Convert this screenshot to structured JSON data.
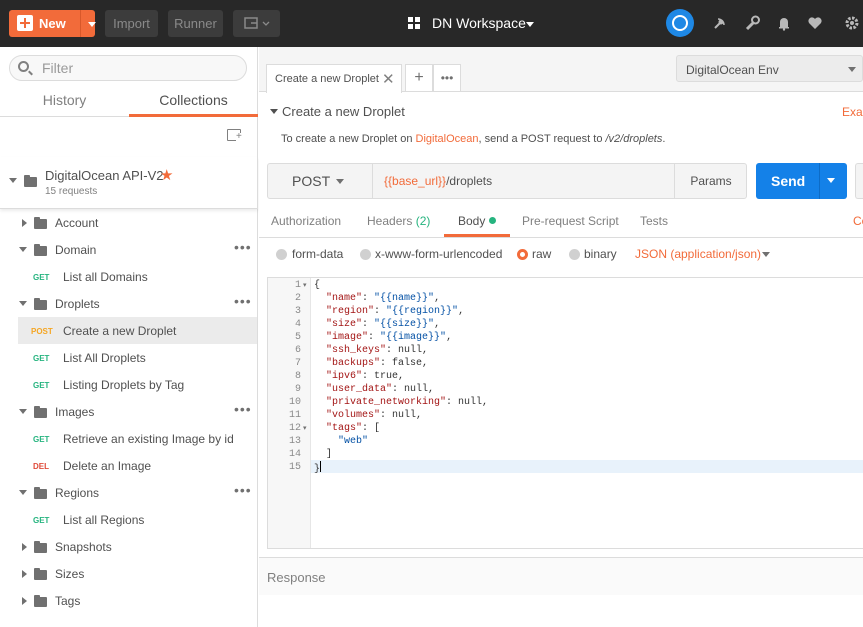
{
  "topbar": {
    "new_label": "New",
    "import_label": "Import",
    "runner_label": "Runner",
    "workspace_name": "DN Workspace",
    "icons": [
      "sync-icon",
      "satellite-icon",
      "wrench-icon",
      "bell-icon",
      "heart-icon",
      "settings-icon"
    ]
  },
  "sidebar": {
    "filter_placeholder": "Filter",
    "tabs": [
      {
        "label": "History"
      },
      {
        "label": "Collections",
        "active": true
      }
    ],
    "collection": {
      "name": "DigitalOcean API-V2",
      "count": "15 requests",
      "starred": true
    },
    "items": [
      {
        "type": "folder",
        "label": "Account",
        "expanded": false
      },
      {
        "type": "folder",
        "label": "Domain",
        "expanded": true
      },
      {
        "type": "request",
        "method": "GET",
        "label": "List all Domains"
      },
      {
        "type": "folder",
        "label": "Droplets",
        "expanded": true
      },
      {
        "type": "request",
        "method": "POST",
        "label": "Create a new Droplet",
        "selected": true
      },
      {
        "type": "request",
        "method": "GET",
        "label": "List All Droplets"
      },
      {
        "type": "request",
        "method": "GET",
        "label": "Listing Droplets by Tag"
      },
      {
        "type": "folder",
        "label": "Images",
        "expanded": true
      },
      {
        "type": "request",
        "method": "GET",
        "label": "Retrieve an existing Image by id"
      },
      {
        "type": "request",
        "method": "DEL",
        "label": "Delete an Image"
      },
      {
        "type": "folder",
        "label": "Regions",
        "expanded": true
      },
      {
        "type": "request",
        "method": "GET",
        "label": "List all Regions"
      },
      {
        "type": "folder",
        "label": "Snapshots",
        "expanded": false
      },
      {
        "type": "folder",
        "label": "Sizes",
        "expanded": false
      },
      {
        "type": "folder",
        "label": "Tags",
        "expanded": false
      }
    ]
  },
  "main": {
    "tab_label": "Create a new Droplet",
    "environment": "DigitalOcean Env",
    "request_title": "Create a new Droplet",
    "examples_label": "Exar",
    "description": {
      "prefix": "To create a new Droplet on ",
      "link": "DigitalOcean",
      "middle": ", send a POST request to ",
      "path": "/v2/droplets",
      "suffix": "."
    },
    "method": "POST",
    "url_var": "{{base_url}}",
    "url_path": "/droplets",
    "params_label": "Params",
    "send_label": "Send",
    "subtabs": {
      "authorization": "Authorization",
      "headers": "Headers",
      "headers_count": "(2)",
      "body": "Body",
      "prerequest": "Pre-request Script",
      "tests": "Tests",
      "cookies": "Co"
    },
    "body_types": {
      "form_data": "form-data",
      "urlencoded": "x-www-form-urlencoded",
      "raw": "raw",
      "binary": "binary",
      "selected": "raw",
      "content_type": "JSON (application/json)"
    },
    "code_lines": [
      "{",
      "  \"name\": \"{{name}}\",",
      "  \"region\": \"{{region}}\",",
      "  \"size\": \"{{size}}\",",
      "  \"image\": \"{{image}}\",",
      "  \"ssh_keys\": null,",
      "  \"backups\": false,",
      "  \"ipv6\": true,",
      "  \"user_data\": null,",
      "  \"private_networking\": null,",
      "  \"volumes\": null,",
      "  \"tags\": [",
      "    \"web\"",
      "  ]",
      "}"
    ],
    "line_numbers": [
      "1",
      "2",
      "3",
      "4",
      "5",
      "6",
      "7",
      "8",
      "9",
      "10",
      "11",
      "12",
      "13",
      "14",
      "15"
    ],
    "response_label": "Response"
  },
  "colors": {
    "accent": "#f26b3a",
    "send": "#1481e8",
    "topbar": "#282828",
    "get": "#26b47f",
    "post": "#f5a623",
    "del": "#e04b3a"
  }
}
